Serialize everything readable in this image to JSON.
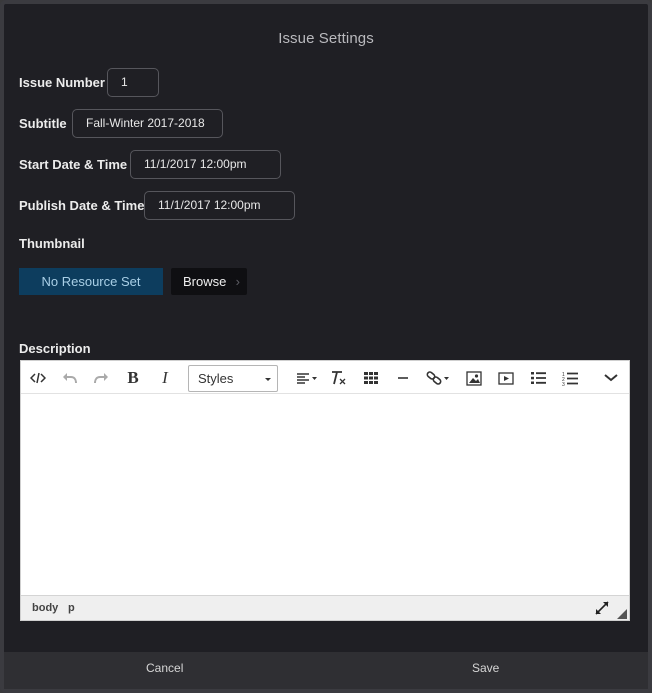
{
  "dialog": {
    "title": "Issue Settings"
  },
  "form": {
    "issue_number": {
      "label": "Issue Number",
      "value": "1"
    },
    "subtitle": {
      "label": "Subtitle",
      "value": "Fall-Winter 2017-2018"
    },
    "start_date": {
      "label": "Start Date & Time",
      "value": "11/1/2017 12:00pm"
    },
    "publish_date": {
      "label": "Publish Date & Time",
      "value": "11/1/2017 12:00pm"
    },
    "thumbnail": {
      "label": "Thumbnail",
      "no_resource_label": "No Resource Set",
      "browse_label": "Browse"
    },
    "description": {
      "label": "Description"
    }
  },
  "editor": {
    "styles_label": "Styles",
    "toolbar_icons": [
      "code-icon",
      "undo-icon",
      "redo-icon",
      "bold-icon",
      "italic-icon",
      "align-icon",
      "clear-format-icon",
      "table-icon",
      "horizontal-rule-icon",
      "link-icon",
      "image-icon",
      "media-icon",
      "bullet-list-icon",
      "numbered-list-icon",
      "more-icon"
    ],
    "bold_glyph": "B",
    "italic_glyph": "I",
    "path": [
      "body",
      "p"
    ]
  },
  "footer": {
    "cancel_label": "Cancel",
    "save_label": "Save"
  }
}
